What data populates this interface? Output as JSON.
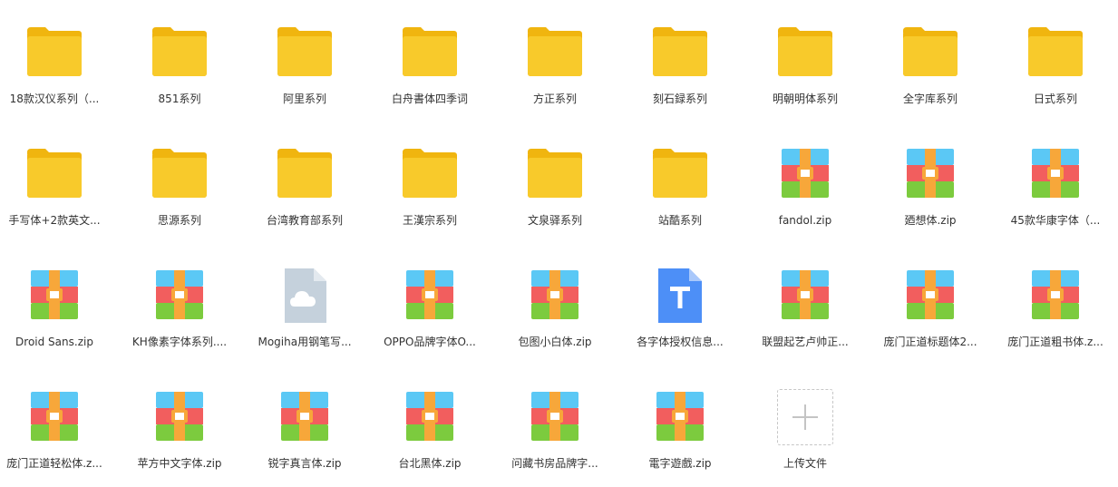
{
  "colors": {
    "folder_back": "#F0B50F",
    "folder_front": "#F8CA2B",
    "zip_blue": "#5BC8F5",
    "zip_red": "#F25E5E",
    "zip_green": "#7CCB3E",
    "zip_strap": "#F7A73A",
    "cloud_doc": "#C5D1DC",
    "text_doc": "#4D8FF7"
  },
  "files": [
    {
      "name": "18款汉仪系列（...",
      "icon": "folder-icon",
      "type": "folder"
    },
    {
      "name": "851系列",
      "icon": "folder-icon",
      "type": "folder"
    },
    {
      "name": "阿里系列",
      "icon": "folder-icon",
      "type": "folder"
    },
    {
      "name": "白舟書体四季词",
      "icon": "folder-icon",
      "type": "folder"
    },
    {
      "name": "方正系列",
      "icon": "folder-icon",
      "type": "folder"
    },
    {
      "name": "刻石録系列",
      "icon": "folder-icon",
      "type": "folder"
    },
    {
      "name": "明朝明体系列",
      "icon": "folder-icon",
      "type": "folder"
    },
    {
      "name": "全字库系列",
      "icon": "folder-icon",
      "type": "folder"
    },
    {
      "name": "日式系列",
      "icon": "folder-icon",
      "type": "folder"
    },
    {
      "name": "手写体+2款英文...",
      "icon": "folder-icon",
      "type": "folder"
    },
    {
      "name": "思源系列",
      "icon": "folder-icon",
      "type": "folder"
    },
    {
      "name": "台湾教育部系列",
      "icon": "folder-icon",
      "type": "folder"
    },
    {
      "name": "王漢宗系列",
      "icon": "folder-icon",
      "type": "folder"
    },
    {
      "name": "文泉驿系列",
      "icon": "folder-icon",
      "type": "folder"
    },
    {
      "name": "站酷系列",
      "icon": "folder-icon",
      "type": "folder"
    },
    {
      "name": "fandol.zip",
      "icon": "zip-archive-icon",
      "type": "zip"
    },
    {
      "name": "廼想体.zip",
      "icon": "zip-archive-icon",
      "type": "zip"
    },
    {
      "name": "45款华康字体（...",
      "icon": "zip-archive-icon",
      "type": "zip"
    },
    {
      "name": "Droid Sans.zip",
      "icon": "zip-archive-icon",
      "type": "zip"
    },
    {
      "name": "KH像素字体系列....",
      "icon": "zip-archive-icon",
      "type": "zip"
    },
    {
      "name": "Mogiha用钢笔写...",
      "icon": "cloud-file-icon",
      "type": "cloud"
    },
    {
      "name": "OPPO品牌字体O...",
      "icon": "zip-archive-icon",
      "type": "zip"
    },
    {
      "name": "包图小白体.zip",
      "icon": "zip-archive-icon",
      "type": "zip"
    },
    {
      "name": "各字体授权信息...",
      "icon": "text-file-icon",
      "type": "text"
    },
    {
      "name": "联盟起艺卢帅正...",
      "icon": "zip-archive-icon",
      "type": "zip"
    },
    {
      "name": "庞门正道标题体2...",
      "icon": "zip-archive-icon",
      "type": "zip"
    },
    {
      "name": "庞门正道粗书体.z...",
      "icon": "zip-archive-icon",
      "type": "zip"
    },
    {
      "name": "庞门正道轻松体.z...",
      "icon": "zip-archive-icon",
      "type": "zip"
    },
    {
      "name": "苹方中文字体.zip",
      "icon": "zip-archive-icon",
      "type": "zip"
    },
    {
      "name": "锐字真言体.zip",
      "icon": "zip-archive-icon",
      "type": "zip"
    },
    {
      "name": "台北黑体.zip",
      "icon": "zip-archive-icon",
      "type": "zip"
    },
    {
      "name": "问藏书房品牌字...",
      "icon": "zip-archive-icon",
      "type": "zip"
    },
    {
      "name": "電字遊戲.zip",
      "icon": "zip-archive-icon",
      "type": "zip"
    }
  ],
  "upload": {
    "label": "上传文件",
    "icon": "plus-icon"
  }
}
